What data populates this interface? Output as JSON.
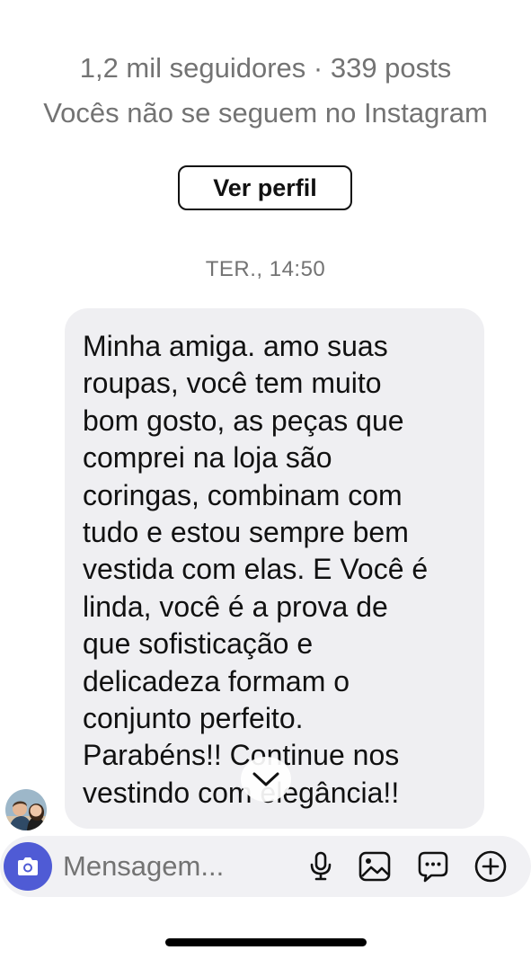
{
  "header": {
    "profile_stats": "1,2 mil seguidores · 339 posts",
    "follow_note": "Vocês não se seguem no Instagram",
    "view_profile_label": "Ver perfil"
  },
  "thread": {
    "timestamp": "TER., 14:50",
    "message": {
      "text": "Minha amiga.  amo suas\nroupas, você tem muito\nbom gosto, as peças que\ncomprei na loja são\ncoringas, combinam com\ntudo e estou sempre bem\nvestida com elas. E Você é\nlinda, você é a prova de\nque sofisticação e\ndelicadeza formam o\nconjunto perfeito.\nParabéns!! Continue nos\nvestindo com elegância!!"
    }
  },
  "composer": {
    "placeholder": "Mensagem...",
    "icons": [
      "camera-icon",
      "microphone-icon",
      "gallery-icon",
      "sticker-icon",
      "plus-icon"
    ]
  },
  "colors": {
    "accent": "#4f5bd5",
    "bubble": "#efeff2",
    "muted_text": "#737373"
  }
}
